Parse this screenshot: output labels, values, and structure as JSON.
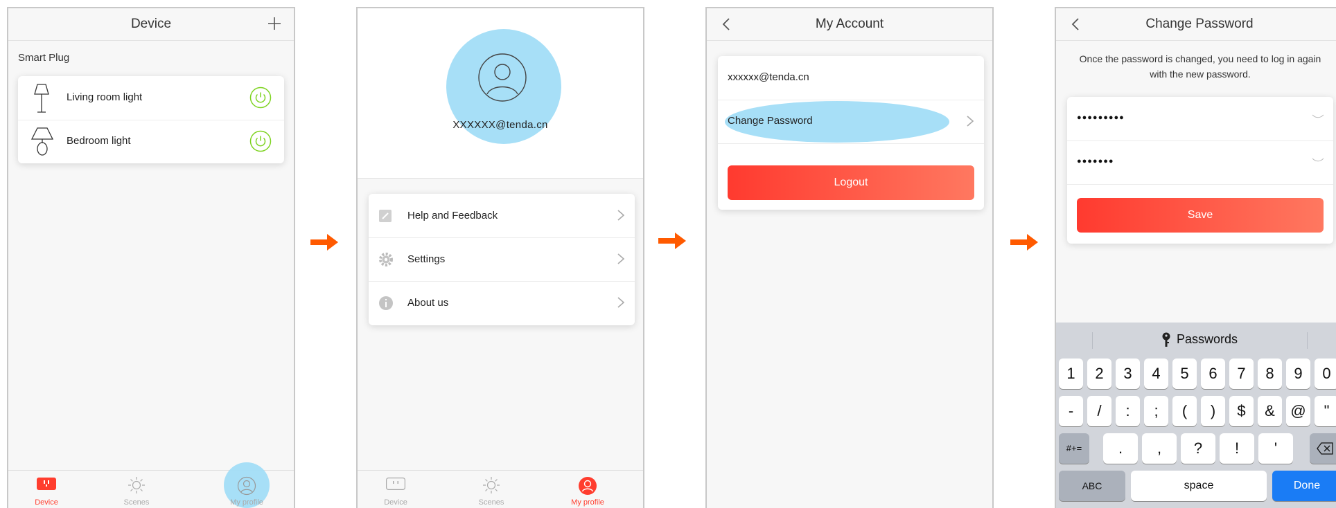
{
  "colors": {
    "accent": "#ff3d2e",
    "highlight": "#9fdcf6",
    "arrow": "#ff5a00",
    "done_blue": "#1a7cf5",
    "power_green": "#7ed321"
  },
  "screen1": {
    "title": "Device",
    "section": "Smart Plug",
    "devices": [
      {
        "name": "Living room light",
        "icon": "floor-lamp-icon"
      },
      {
        "name": "Bedroom light",
        "icon": "table-lamp-icon"
      }
    ],
    "tabs": [
      {
        "label": "Device",
        "icon": "plug-icon",
        "active": true
      },
      {
        "label": "Scenes",
        "icon": "sun-icon",
        "active": false
      },
      {
        "label": "My profile",
        "icon": "user-icon",
        "active": false
      }
    ]
  },
  "screen2": {
    "email": "XXXXXX@tenda.cn",
    "menu": [
      {
        "label": "Help and Feedback",
        "icon": "edit-icon"
      },
      {
        "label": "Settings",
        "icon": "gear-icon"
      },
      {
        "label": "About us",
        "icon": "info-icon"
      }
    ],
    "tabs": [
      {
        "label": "Device",
        "icon": "plug-icon",
        "active": false
      },
      {
        "label": "Scenes",
        "icon": "sun-icon",
        "active": false
      },
      {
        "label": "My profile",
        "icon": "user-icon",
        "active": true
      }
    ]
  },
  "screen3": {
    "title": "My Account",
    "email": "xxxxxx@tenda.cn",
    "change_password": "Change Password",
    "logout": "Logout"
  },
  "screen4": {
    "title": "Change Password",
    "notice": "Once the password is changed, you need to log in again with the new password.",
    "password1": "●●●●●●●●●",
    "password2": "●●●●●●●",
    "save": "Save",
    "keyboard": {
      "bar_label": "Passwords",
      "row1": [
        "1",
        "2",
        "3",
        "4",
        "5",
        "6",
        "7",
        "8",
        "9",
        "0"
      ],
      "row2": [
        "-",
        "/",
        ":",
        ";",
        "(",
        ")",
        "$",
        "&",
        "@",
        "\""
      ],
      "row3_left": "#+=",
      "row3": [
        ".",
        ",",
        "?",
        "!",
        "'"
      ],
      "abc": "ABC",
      "space": "space",
      "done": "Done"
    }
  }
}
